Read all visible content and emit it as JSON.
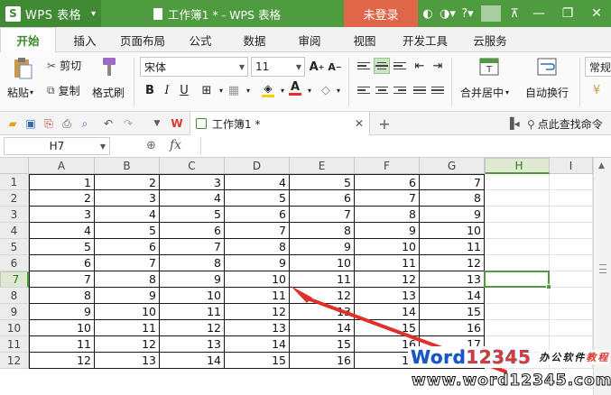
{
  "titlebar": {
    "app_name": "WPS 表格",
    "doc_title": "工作簿1 * - WPS 表格",
    "login_label": "未登录",
    "colors": {
      "bar": "#4f9c40",
      "login": "#e0664a"
    }
  },
  "tabs": [
    {
      "label": "开始",
      "active": true
    },
    {
      "label": "插入"
    },
    {
      "label": "页面布局"
    },
    {
      "label": "公式"
    },
    {
      "label": "数据"
    },
    {
      "label": "审阅"
    },
    {
      "label": "视图"
    },
    {
      "label": "开发工具"
    },
    {
      "label": "云服务"
    }
  ],
  "ribbon": {
    "cut": "剪切",
    "paste": "粘贴",
    "copy": "复制",
    "format_painter": "格式刷",
    "font_name": "宋体",
    "font_size": "11",
    "merge_center": "合并居中",
    "wrap_text": "自动换行",
    "overflow_label": "常规"
  },
  "quickbar": {
    "doc_tab_label": "工作簿1 *",
    "search_label": "点此查找命令"
  },
  "formula_bar": {
    "name_box": "H7",
    "fx": "fx",
    "value": ""
  },
  "sheet": {
    "columns": [
      "A",
      "B",
      "C",
      "D",
      "E",
      "F",
      "G",
      "H",
      "I"
    ],
    "selected_column": "H",
    "selected_row": 7,
    "rows": [
      {
        "num": 1,
        "cells": [
          1,
          2,
          3,
          4,
          5,
          6,
          7
        ]
      },
      {
        "num": 2,
        "cells": [
          2,
          3,
          4,
          5,
          6,
          7,
          8
        ]
      },
      {
        "num": 3,
        "cells": [
          3,
          4,
          5,
          6,
          7,
          8,
          9
        ]
      },
      {
        "num": 4,
        "cells": [
          4,
          5,
          6,
          7,
          8,
          9,
          10
        ]
      },
      {
        "num": 5,
        "cells": [
          5,
          6,
          7,
          8,
          9,
          10,
          11
        ]
      },
      {
        "num": 6,
        "cells": [
          6,
          7,
          8,
          9,
          10,
          11,
          12
        ]
      },
      {
        "num": 7,
        "cells": [
          7,
          8,
          9,
          10,
          11,
          12,
          13
        ]
      },
      {
        "num": 8,
        "cells": [
          8,
          9,
          10,
          11,
          12,
          13,
          14
        ]
      },
      {
        "num": 9,
        "cells": [
          9,
          10,
          11,
          12,
          13,
          14,
          15
        ]
      },
      {
        "num": 10,
        "cells": [
          10,
          11,
          12,
          13,
          14,
          15,
          16
        ]
      },
      {
        "num": 11,
        "cells": [
          11,
          12,
          13,
          14,
          15,
          16,
          17
        ]
      },
      {
        "num": 12,
        "cells": [
          12,
          13,
          14,
          15,
          16,
          17,
          18
        ]
      }
    ]
  },
  "watermark": {
    "brand_word": "Word",
    "brand_num": "12345",
    "cn_black": "办公软件",
    "cn_red": "教程",
    "url": "www.word12345.com"
  },
  "annotation_color": "#e0302a"
}
